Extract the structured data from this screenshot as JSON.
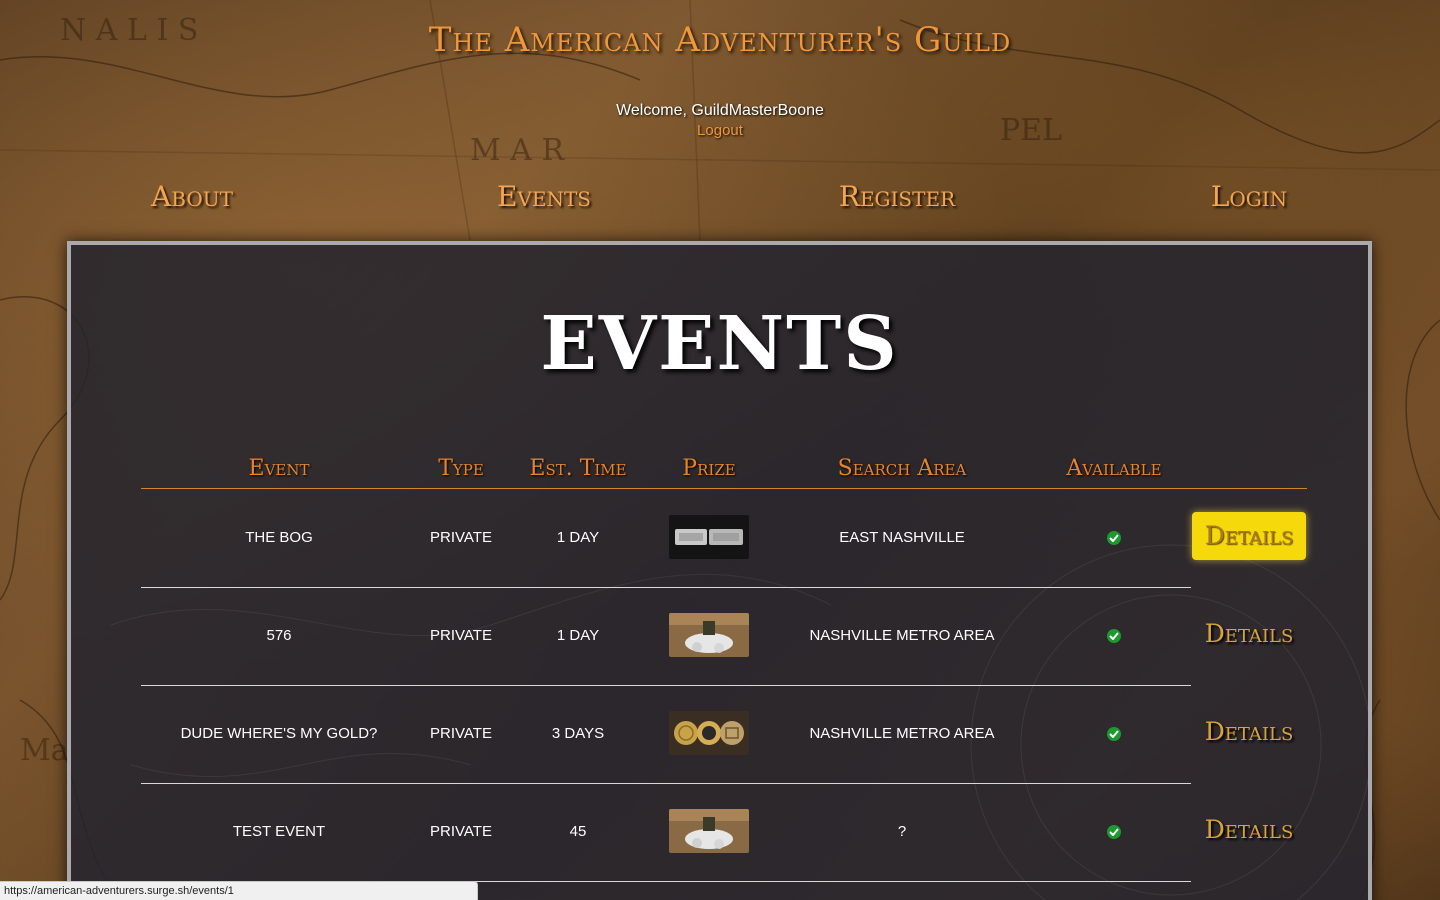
{
  "site": {
    "title": "The American Adventurer's Guild",
    "welcome": "Welcome, GuildMasterBoone",
    "logout": "Logout"
  },
  "nav": {
    "items": [
      {
        "label": "About"
      },
      {
        "label": "Events"
      },
      {
        "label": "Register"
      },
      {
        "label": "Login"
      }
    ]
  },
  "main": {
    "heading": "EVENTS",
    "columns": {
      "event": "Event",
      "type": "Type",
      "est_time": "Est. Time",
      "prize": "Prize",
      "search_area": "Search Area",
      "available": "Available"
    },
    "rows": [
      {
        "event": "THE BOG",
        "type": "PRIVATE",
        "est_time": "1 DAY",
        "prize_icon": "silver-bars-image",
        "search_area": "EAST NASHVILLE",
        "available": true,
        "details": "Details",
        "details_active": true
      },
      {
        "event": "576",
        "type": "PRIVATE",
        "est_time": "1 DAY",
        "prize_icon": "bag-prize-image",
        "search_area": "NASHVILLE METRO AREA",
        "available": true,
        "details": "Details",
        "details_active": false
      },
      {
        "event": "DUDE WHERE'S MY GOLD?",
        "type": "PRIVATE",
        "est_time": "3 DAYS",
        "prize_icon": "gold-coins-image",
        "search_area": "NASHVILLE METRO AREA",
        "available": true,
        "details": "Details",
        "details_active": false
      },
      {
        "event": "TEST EVENT",
        "type": "PRIVATE",
        "est_time": "45",
        "prize_icon": "bag-prize-image",
        "search_area": "?",
        "available": true,
        "details": "Details",
        "details_active": false
      }
    ]
  },
  "statusbar": {
    "url": "https://american-adventurers.surge.sh/events/1"
  },
  "colors": {
    "accent": "#f0973a",
    "available": "#1c9a2e",
    "details_highlight": "#f5d90a"
  }
}
